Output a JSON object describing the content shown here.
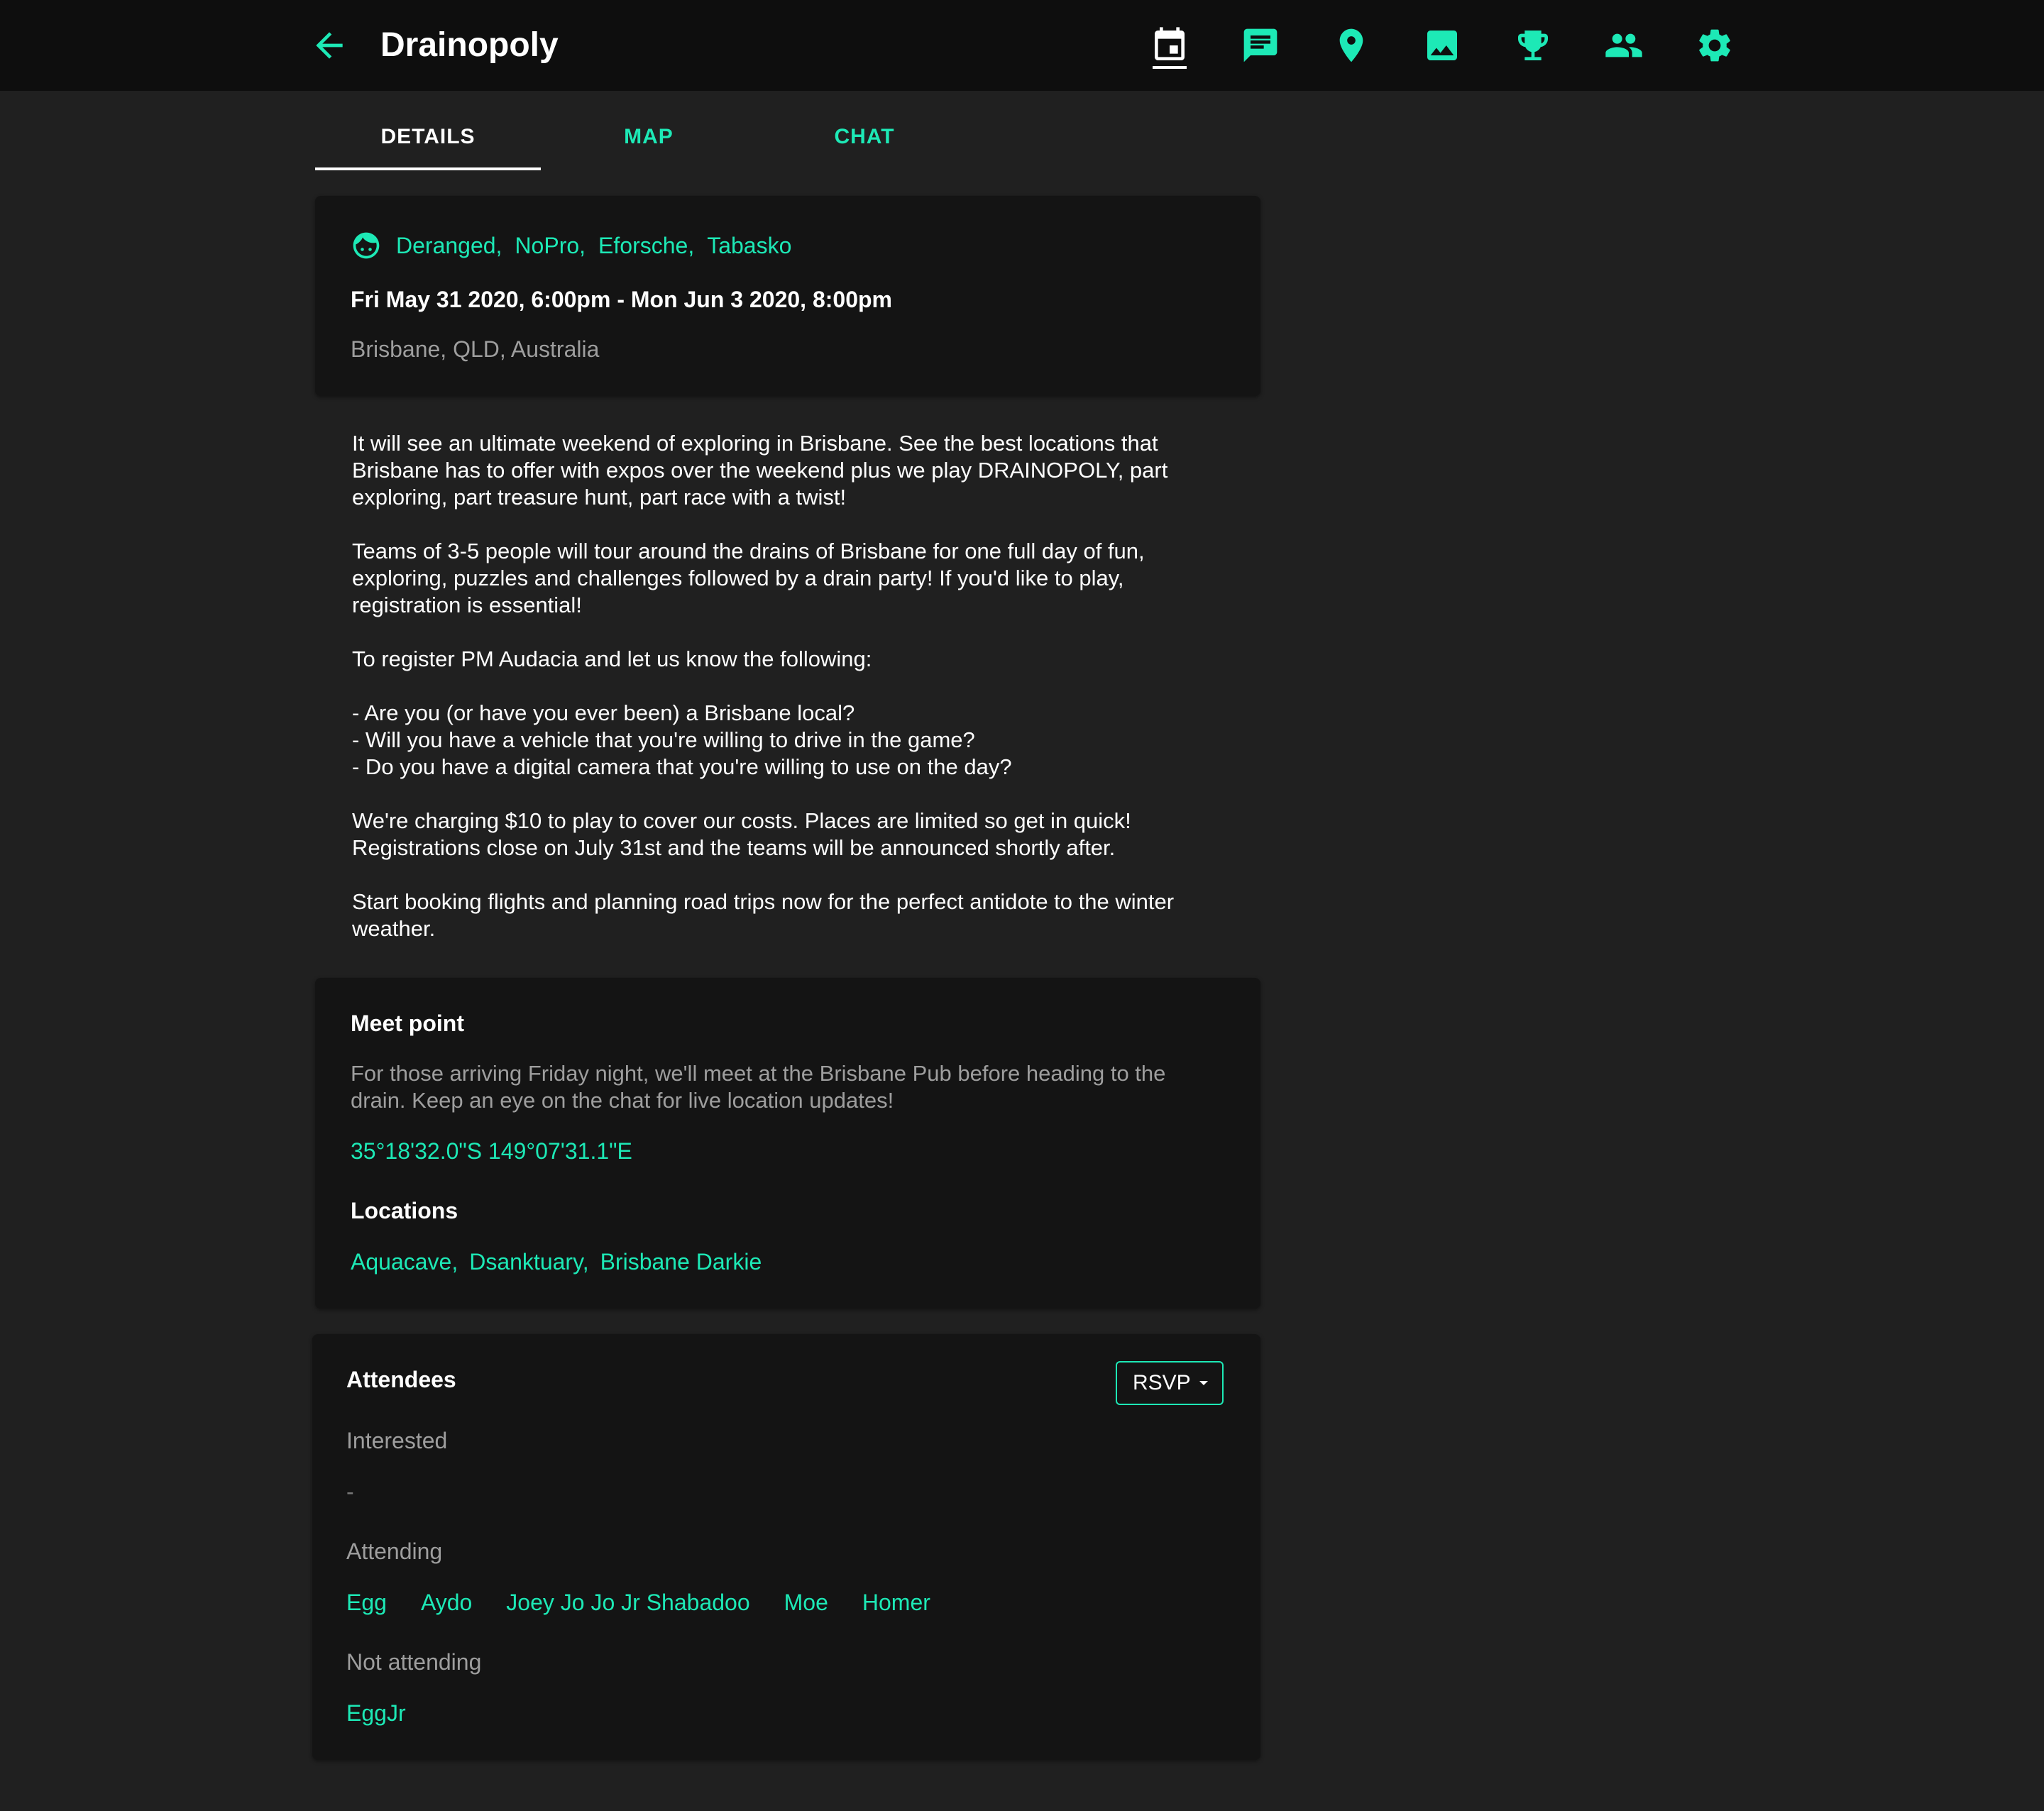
{
  "header": {
    "title": "Drainopoly",
    "back_icon": "arrow-left-icon",
    "nav_icons": [
      "calendar-icon",
      "chat-icon",
      "location-pin-icon",
      "image-icon",
      "trophy-icon",
      "people-icon",
      "gear-icon"
    ],
    "active_icon": "calendar-icon"
  },
  "tabs": [
    {
      "label": "DETAILS",
      "active": true
    },
    {
      "label": "MAP",
      "active": false
    },
    {
      "label": "CHAT",
      "active": false
    }
  ],
  "event": {
    "organizers": [
      "Deranged,",
      "NoPro,",
      "Eforsche,",
      "Tabasko"
    ],
    "datetime": "Fri May 31 2020, 6:00pm - Mon Jun 3 2020, 8:00pm",
    "location": "Brisbane, QLD, Australia"
  },
  "description": {
    "p1": [
      "It will see an ultimate weekend of exploring in Brisbane. See the best locations that",
      "Brisbane has to offer with expos over the weekend plus we play DRAINOPOLY, part",
      "exploring, part treasure hunt, part race with a twist!"
    ],
    "p2": [
      "Teams of 3-5 people will tour around the drains of Brisbane for one full day of fun,",
      "exploring, puzzles and challenges followed by a drain party! If you'd like to play,",
      "registration is essential!"
    ],
    "p3": "To register PM Audacia and let us know the following:",
    "p4": [
      "- Are you (or have you ever been) a Brisbane local?",
      "- Will you have a vehicle that you're willing to drive in the game?",
      "- Do you have a digital camera that you're willing to use on the day?"
    ],
    "p5": [
      "We're charging $10 to play to cover our costs. Places are limited so get in quick!",
      "Registrations close on July 31st and the teams will be announced shortly after."
    ],
    "p6": [
      "Start booking flights and planning road trips now for the perfect antidote to the winter",
      "weather."
    ]
  },
  "meet": {
    "title": "Meet point",
    "text": [
      "For those arriving Friday night, we'll meet at the Brisbane Pub before heading to the",
      "drain. Keep an eye on the chat for live location updates!"
    ],
    "coords": "35°18'32.0\"S 149°07'31.1\"E",
    "locations_title": "Locations",
    "locations": [
      "Aquacave,",
      "Dsanktuary,",
      "Brisbane Darkie"
    ]
  },
  "attendees": {
    "title": "Attendees",
    "rsvp_label": "RSVP",
    "interested_label": "Interested",
    "interested_empty": "-",
    "attending_label": "Attending",
    "attending": [
      "Egg",
      "Aydo",
      "Joey Jo Jo Jr Shabadoo",
      "Moe",
      "Homer"
    ],
    "not_attending_label": "Not attending",
    "not_attending": [
      "EggJr"
    ]
  },
  "colors": {
    "accent": "#1de9b6",
    "background": "#202020",
    "card": "#141414",
    "topbar": "#0e0e0e",
    "muted_text": "#9e9e9e"
  }
}
